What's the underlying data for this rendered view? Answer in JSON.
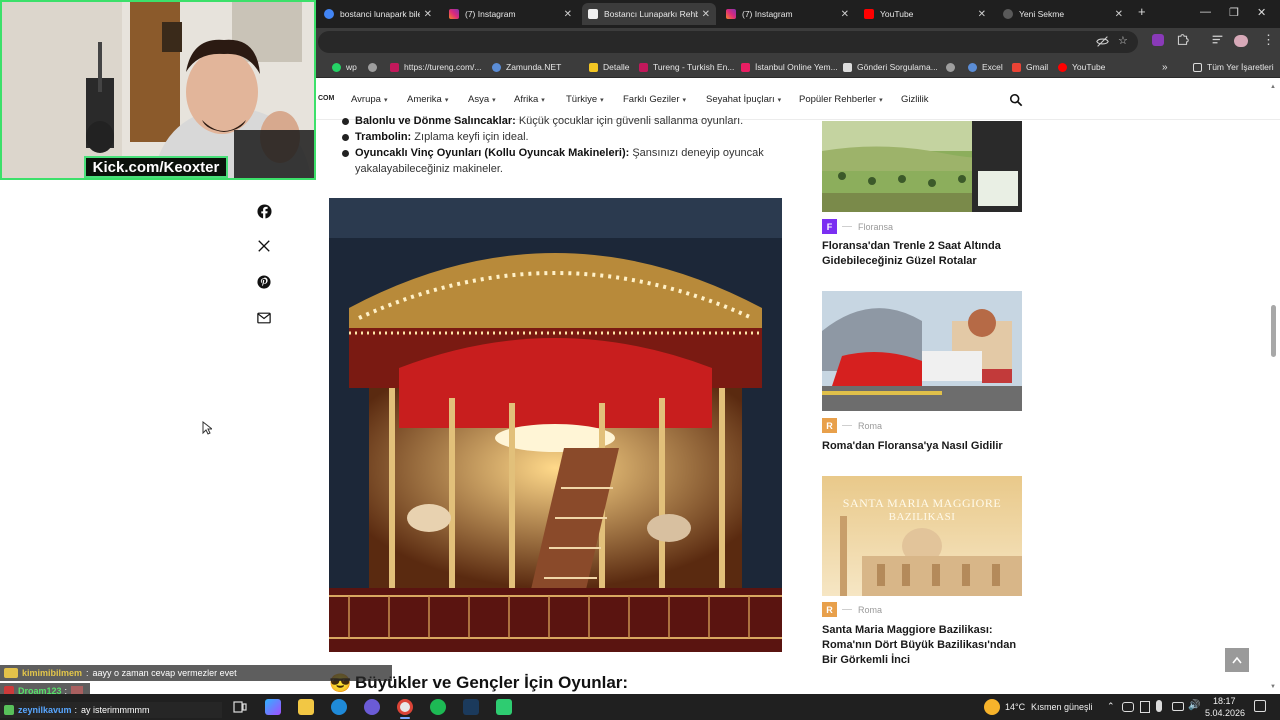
{
  "tabs": [
    {
      "label": "bostanci lunapark bilet fiy",
      "favicon": "google-icon",
      "active": false
    },
    {
      "label": "(7) Instagram",
      "favicon": "instagram-icon",
      "active": false
    },
    {
      "label": "Bostancı Lunaparkı Rehbe",
      "favicon": "site-icon",
      "active": true
    },
    {
      "label": "(7) Instagram",
      "favicon": "instagram-icon",
      "active": false
    },
    {
      "label": "YouTube",
      "favicon": "youtube-icon",
      "active": false
    },
    {
      "label": "Yeni Sekme",
      "favicon": "chrome-icon",
      "active": false
    }
  ],
  "new_tab": "+",
  "bookmarks": [
    {
      "label": "wp",
      "color": "#25d366"
    },
    {
      "label": "",
      "color": "#9e9e9e"
    },
    {
      "label": "https://tureng.com/...",
      "color": "#c2185b"
    },
    {
      "label": "Zamunda.NET",
      "color": "#5b8dd6"
    },
    {
      "label": "Detalle",
      "color": "#f3c623"
    },
    {
      "label": "Tureng - Turkish En...",
      "color": "#c2185b"
    },
    {
      "label": "İstanbul Online Yem...",
      "color": "#e91e63"
    },
    {
      "label": "Gönderi Sorgulama...",
      "color": "#dddddd"
    },
    {
      "label": "",
      "color": "#9e9e9e"
    },
    {
      "label": "Excel",
      "color": "#5b8dd6"
    },
    {
      "label": "Gmail",
      "color": "#ea4335"
    },
    {
      "label": "YouTube",
      "color": "#ff0000"
    }
  ],
  "all_bookmarks": "Tüm Yer İşaretleri",
  "site": {
    "logo_fragment": "COM",
    "nav": [
      {
        "label": "Avrupa",
        "has_menu": true
      },
      {
        "label": "Amerika",
        "has_menu": true
      },
      {
        "label": "Asya",
        "has_menu": true
      },
      {
        "label": "Afrika",
        "has_menu": true
      },
      {
        "label": "Türkiye",
        "has_menu": true
      },
      {
        "label": "Farklı Geziler",
        "has_menu": true
      },
      {
        "label": "Seyahat İpuçları",
        "has_menu": true
      },
      {
        "label": "Popüler Rehberler",
        "has_menu": true
      },
      {
        "label": "Gizlilik",
        "has_menu": false
      }
    ]
  },
  "article": {
    "bullets": [
      {
        "bold": "Balonlu ve Dönme Salıncaklar:",
        "text": " Küçük çocuklar için güvenli sallanma oyunları."
      },
      {
        "bold": "Trambolin:",
        "text": " Zıplama keyfi için ideal."
      },
      {
        "bold": "Oyuncaklı Vinç Oyunları (Kollu Oyuncak Makineleri):",
        "text": " Şansınızı deneyip oyuncak yakalayabileceğiniz makineler.",
        "line1": " Şansınızı deneyip oyuncak",
        "line2": "yakalayabileceğiniz makineler."
      }
    ],
    "image_subject": "carousel",
    "section_emoji": "😎",
    "section_heading": "Büyükler ve Gençler İçin Oyunlar:"
  },
  "share_icons": [
    "facebook-icon",
    "x-icon",
    "pinterest-icon",
    "mail-icon"
  ],
  "sidebar": [
    {
      "badge": "F",
      "badge_color": "#7b2ff2",
      "category": "Floransa",
      "title_l1": "Floransa'dan Trenle 2 Saat Altında",
      "title_l2": "Gidebileceğiniz Güzel Rotalar"
    },
    {
      "badge": "R",
      "badge_color": "#e8a04b",
      "category": "Roma",
      "title_l1": "Roma'dan Floransa'ya Nasıl Gidilir",
      "title_l2": ""
    },
    {
      "badge": "R",
      "badge_color": "#e8a04b",
      "category": "Roma",
      "title_l1": "Santa Maria Maggiore Bazilikası:",
      "title_l2": "Roma'nın Dört Büyük Bazilikası'ndan",
      "title_l3": "Bir Görkemli İnci",
      "image_caption_1": "SANTA MARIA MAGGIORE",
      "image_caption_2": "BAZILIKASI"
    }
  ],
  "overlay": {
    "webcam_label": "Kick.com/Keoxter",
    "chat": [
      {
        "user": "kimimibilmem",
        "text": "aayy o zaman cevap vermezler evet",
        "user_color": "#e3c64a"
      },
      {
        "user": "Droam123",
        "text": "",
        "user_color": "#58e06b"
      },
      {
        "user": "zeynilkavum",
        "text": "ay isterimmmmm",
        "user_color": "#58a6ff"
      }
    ]
  },
  "taskbar": {
    "weather_temp": "14°C",
    "weather_text": "Kısmen güneşli",
    "time": "18:17",
    "date": "5.04.2026"
  }
}
